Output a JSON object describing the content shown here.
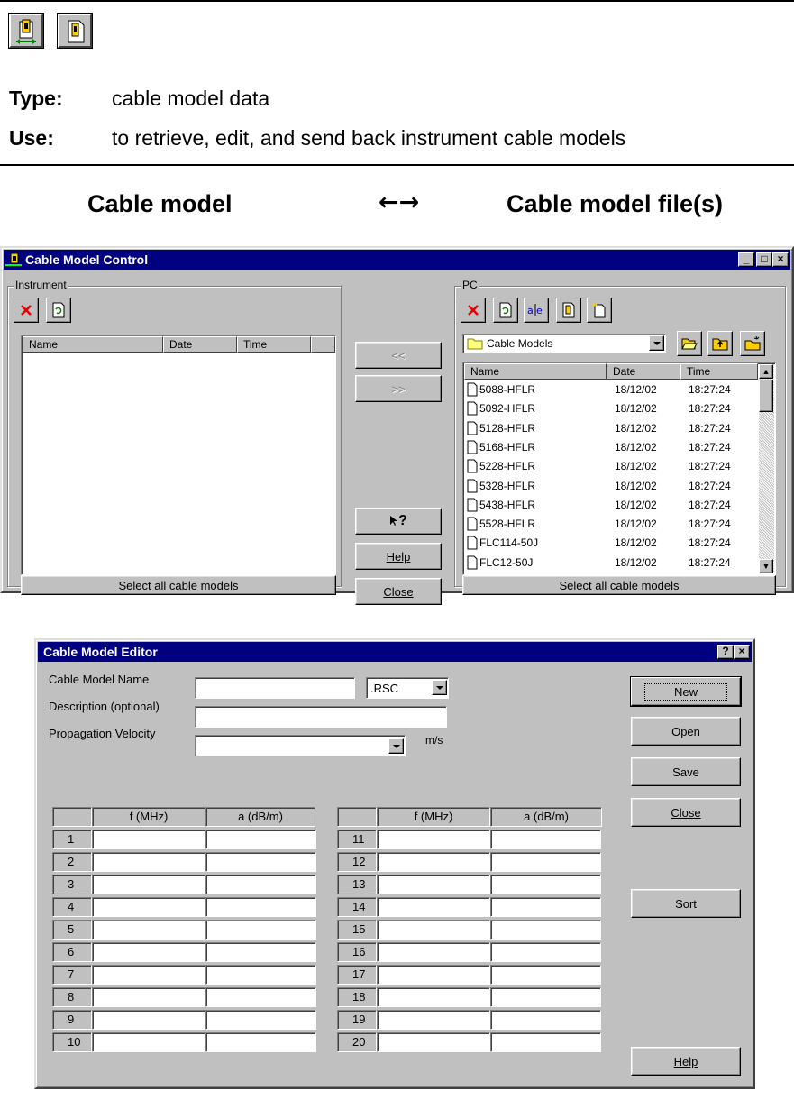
{
  "doc": {
    "type_label": "Type:",
    "type_value": "cable model data",
    "use_label": "Use:",
    "use_value": "to retrieve, edit, and send back instrument cable models",
    "mapping_left": "Cable model",
    "mapping_arrow": "←→",
    "mapping_right": "Cable model file(s)",
    "icons": [
      "cable-model-transfer-icon",
      "cable-model-file-icon"
    ]
  },
  "control": {
    "title": "Cable Model Control",
    "instrument": {
      "label": "Instrument",
      "columns": [
        "Name",
        "Date",
        "Time"
      ],
      "select_all": "Select all cable models"
    },
    "transfer_left": "<<",
    "transfer_right": ">>",
    "whats_this": "?",
    "help": "Help",
    "close": "Close",
    "pc": {
      "label": "PC",
      "folder": "Cable Models",
      "columns": [
        "Name",
        "Date",
        "Time"
      ],
      "files": [
        {
          "name": "5088-HFLR",
          "date": "18/12/02",
          "time": "18:27:24"
        },
        {
          "name": "5092-HFLR",
          "date": "18/12/02",
          "time": "18:27:24"
        },
        {
          "name": "5128-HFLR",
          "date": "18/12/02",
          "time": "18:27:24"
        },
        {
          "name": "5168-HFLR",
          "date": "18/12/02",
          "time": "18:27:24"
        },
        {
          "name": "5228-HFLR",
          "date": "18/12/02",
          "time": "18:27:24"
        },
        {
          "name": "5328-HFLR",
          "date": "18/12/02",
          "time": "18:27:24"
        },
        {
          "name": "5438-HFLR",
          "date": "18/12/02",
          "time": "18:27:24"
        },
        {
          "name": "5528-HFLR",
          "date": "18/12/02",
          "time": "18:27:24"
        },
        {
          "name": "FLC114-50J",
          "date": "18/12/02",
          "time": "18:27:24"
        },
        {
          "name": "FLC12-50J",
          "date": "18/12/02",
          "time": "18:27:24"
        }
      ],
      "select_all": "Select all cable models"
    }
  },
  "editor": {
    "title": "Cable Model Editor",
    "name_label": "Cable Model Name",
    "name_value": "",
    "ext_value": ".RSC",
    "desc_label": "Description (optional)",
    "desc_value": "",
    "velocity_label": "Propagation Velocity",
    "velocity_value": "",
    "velocity_unit": "m/s",
    "col_f": "f (MHz)",
    "col_a": "a (dB/m)",
    "rows_left": [
      "1",
      "2",
      "3",
      "4",
      "5",
      "6",
      "7",
      "8",
      "9",
      "10"
    ],
    "rows_right": [
      "11",
      "12",
      "13",
      "14",
      "15",
      "16",
      "17",
      "18",
      "19",
      "20"
    ],
    "buttons": {
      "new": "New",
      "open": "Open",
      "save": "Save",
      "close": "Close",
      "sort": "Sort",
      "help": "Help"
    }
  }
}
